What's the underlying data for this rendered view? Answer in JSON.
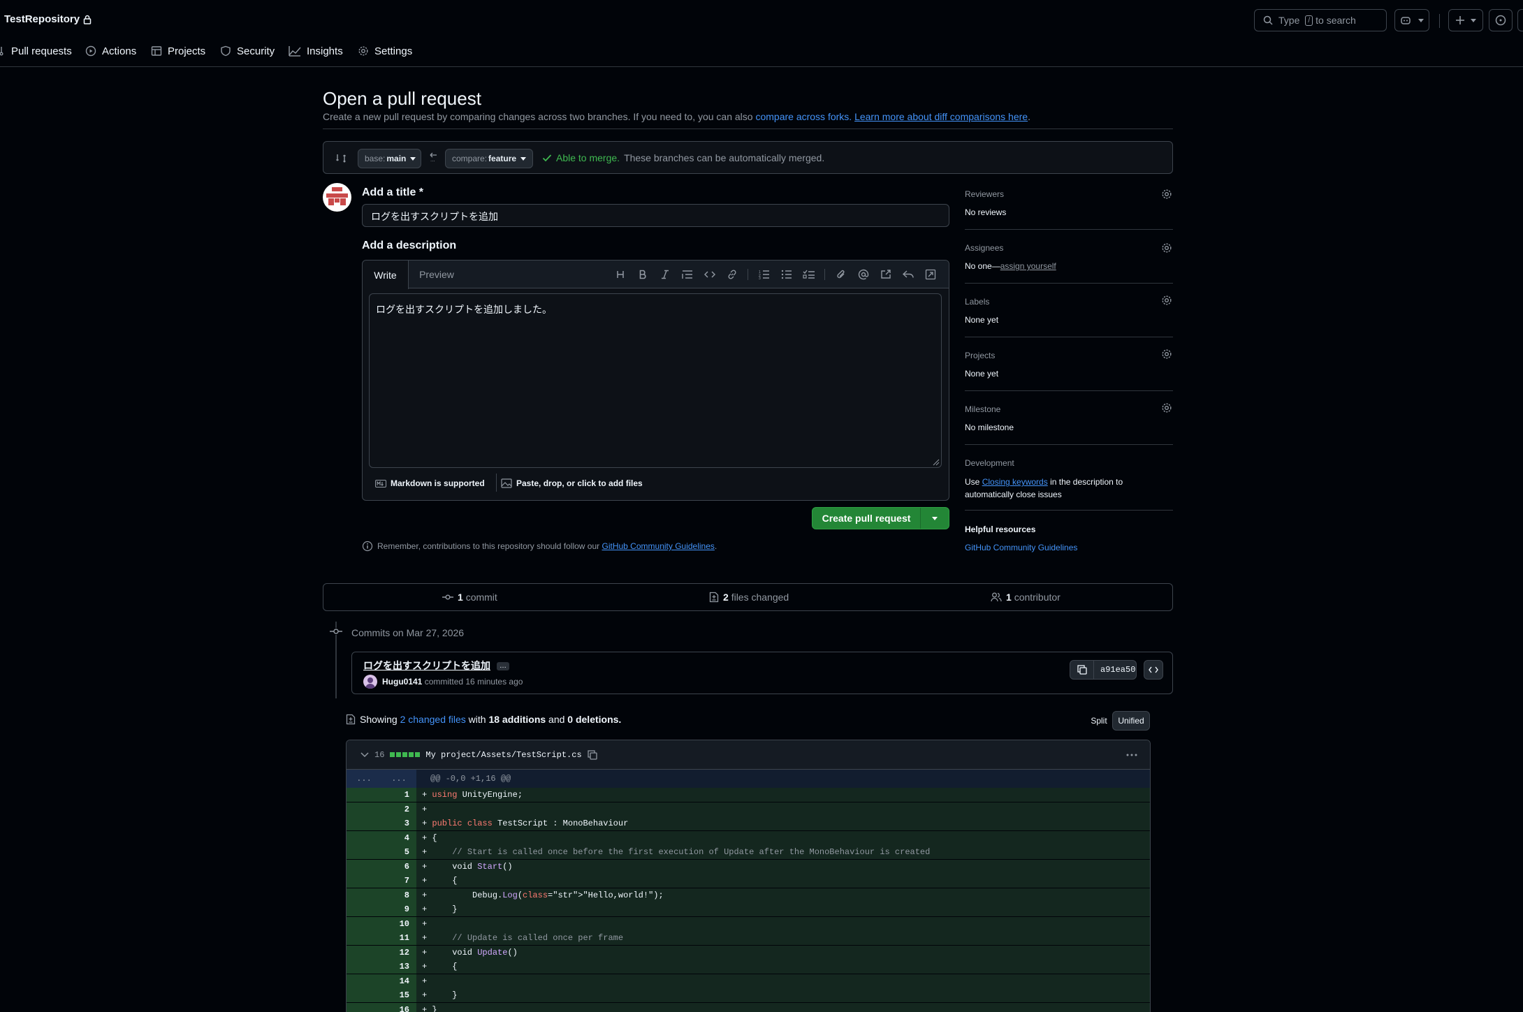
{
  "header": {
    "repo_name": "TestRepository",
    "search_prefix": "Type",
    "search_key": "/",
    "search_suffix": "to search",
    "nav": [
      {
        "label": "Pull requests",
        "icon": "pull-request-icon"
      },
      {
        "label": "Actions",
        "icon": "play-icon"
      },
      {
        "label": "Projects",
        "icon": "table-icon"
      },
      {
        "label": "Security",
        "icon": "shield-icon"
      },
      {
        "label": "Insights",
        "icon": "graph-icon"
      },
      {
        "label": "Settings",
        "icon": "gear-icon"
      }
    ]
  },
  "page": {
    "title": "Open a pull request",
    "subtitle_text": "Create a new pull request by comparing changes across two branches. If you need to, you can also",
    "compare_forks_link": "compare across forks.",
    "learn_more_link": "Learn more about diff comparisons here",
    "period": "."
  },
  "compare": {
    "base_prefix": "base:",
    "base_branch": "main",
    "compare_prefix": "compare:",
    "compare_branch": "feature",
    "merge_status": "Able to merge.",
    "merge_note": "These branches can be automatically merged."
  },
  "form": {
    "title_label": "Add a title *",
    "title_value": "ログを出すスクリプトを追加",
    "description_label": "Add a description",
    "tab_write": "Write",
    "tab_preview": "Preview",
    "description_value": "ログを出すスクリプトを追加しました。",
    "markdown_note": "Markdown is supported",
    "attach_note": "Paste, drop, or click to add files",
    "create_button": "Create pull request",
    "remember_text": "Remember, contributions to this repository should follow our",
    "guidelines_link": "GitHub Community Guidelines",
    "remember_period": "."
  },
  "sidebar": {
    "reviewers_label": "Reviewers",
    "reviewers_value": "No reviews",
    "assignees_label": "Assignees",
    "assignees_value": "No one—",
    "assign_yourself": "assign yourself",
    "labels_label": "Labels",
    "labels_value": "None yet",
    "projects_label": "Projects",
    "projects_value": "None yet",
    "milestone_label": "Milestone",
    "milestone_value": "No milestone",
    "development_label": "Development",
    "dev_text_1": "Use",
    "closing_keywords": "Closing keywords",
    "dev_text_2": "in the description to",
    "dev_text_3": "automatically close issues",
    "helpful_label": "Helpful resources",
    "helpful_link": "GitHub Community Guidelines"
  },
  "stats": {
    "commits_count": "1",
    "commits_label": "commit",
    "files_count": "2",
    "files_label": "files changed",
    "contrib_count": "1",
    "contrib_label": "contributor"
  },
  "commits": {
    "date_header": "Commits on Mar 27, 2026",
    "message": "ログを出すスクリプトを追加",
    "author": "Hugu0141",
    "meta": "committed 16 minutes ago",
    "sha": "a91ea50"
  },
  "diff_summary": {
    "showing": "Showing",
    "changed_files": "2 changed files",
    "with": "with",
    "additions": "18 additions",
    "and": "and",
    "deletions": "0 deletions.",
    "split": "Split",
    "unified": "Unified"
  },
  "diff": {
    "count": "16",
    "path": "My project/Assets/TestScript.cs",
    "hunk_left": "...",
    "hunk_right": "...",
    "hunk_header": "@@ -0,0 +1,16 @@",
    "line_numbers": [
      "1",
      "2",
      "3",
      "4",
      "5",
      "6",
      "7",
      "8",
      "9",
      "10",
      "11",
      "12",
      "13",
      "14",
      "15",
      "16"
    ],
    "lines": [
      "+ using UnityEngine;",
      "+",
      "+ public class TestScript : MonoBehaviour",
      "+ {",
      "+     // Start is called once before the first execution of Update after the MonoBehaviour is created",
      "+     void Start()",
      "+     {",
      "+         Debug.Log(\"Hello,world!\");",
      "+     }",
      "+",
      "+     // Update is called once per frame",
      "+     void Update()",
      "+     {",
      "+",
      "+     }",
      "+ }"
    ]
  },
  "colors": {
    "background": "#010409",
    "accent_link": "#4493f8",
    "create_button": "#238636",
    "merge_ok": "#3fb950",
    "diff_add_bg": "#14271f"
  }
}
